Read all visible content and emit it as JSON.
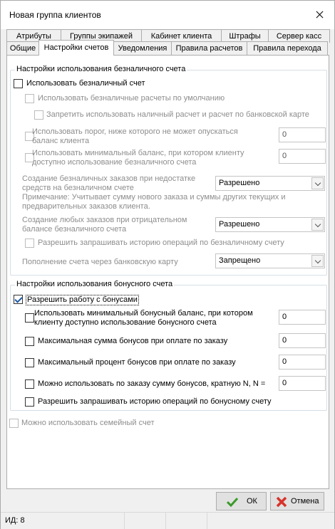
{
  "window": {
    "title": "Новая группа клиентов"
  },
  "tabs_row1": [
    "Атрибуты",
    "Группы экипажей",
    "Кабинет клиента",
    "Штрафы",
    "Сервер касс"
  ],
  "tabs_row2": [
    "Общие",
    "Настройки счетов",
    "Уведомления",
    "Правила расчетов",
    "Правила перехода"
  ],
  "active_tab": "Настройки счетов",
  "noncash": {
    "title": "Настройки использования безналичного счета",
    "use_account": {
      "label": "Использовать безналичный счет",
      "checked": false
    },
    "default_noncash": {
      "label": "Использовать безналичные расчеты по умолчанию",
      "checked": false
    },
    "forbid_cash": {
      "label": "Запретить использовать наличный расчет и расчет по банковской карте",
      "checked": false
    },
    "threshold": {
      "line1": "Использовать порог, ниже которого не может опускаться",
      "line2": "баланс клиента",
      "value": "0"
    },
    "min_balance": {
      "line1": "Использовать минимальный баланс, при котором клиенту",
      "line2": "доступно использование безналичного счета",
      "value": "0"
    },
    "insufficient": {
      "line1": "Создание безналичных заказов при недостатке",
      "line2": "средств на безналичном счете",
      "value": "Разрешено"
    },
    "note": {
      "line1": "Примечание: Учитывает сумму нового заказа и суммы других текущих и",
      "line2": "предварительных заказов клиента."
    },
    "negative": {
      "line1": "Создание любых заказов при отрицательном",
      "line2": "балансе безналичного счета",
      "value": "Разрешено"
    },
    "history": {
      "label": "Разрешить запрашивать историю операций по безналичному счету",
      "checked": false
    },
    "topup": {
      "label": "Пополнение счета через банковскую карту",
      "value": "Запрещено"
    }
  },
  "bonus": {
    "title": "Настройки использования бонусного счета",
    "allow": {
      "label": "Разрешить работу с бонусами",
      "checked": true
    },
    "min_balance": {
      "line1": "Использовать минимальный бонусный баланс, при котором",
      "line2": "клиенту доступно использование бонусного счета",
      "value": "0"
    },
    "max_sum": {
      "label": "Максимальная сумма бонусов при оплате по заказу",
      "value": "0"
    },
    "max_percent": {
      "label": "Максимальный процент бонусов при оплате по заказу",
      "value": "0"
    },
    "multiple": {
      "label": "Можно использовать по заказу сумму бонусов, кратную N, N =",
      "value": "0"
    },
    "history": {
      "label": "Разрешить запрашивать историю операций по бонусному счету",
      "checked": false
    }
  },
  "family": {
    "label": "Можно использовать семейный счет",
    "checked": false
  },
  "buttons": {
    "ok": "ОК",
    "cancel": "Отмена"
  },
  "status": {
    "id_text": "ИД: 8"
  }
}
